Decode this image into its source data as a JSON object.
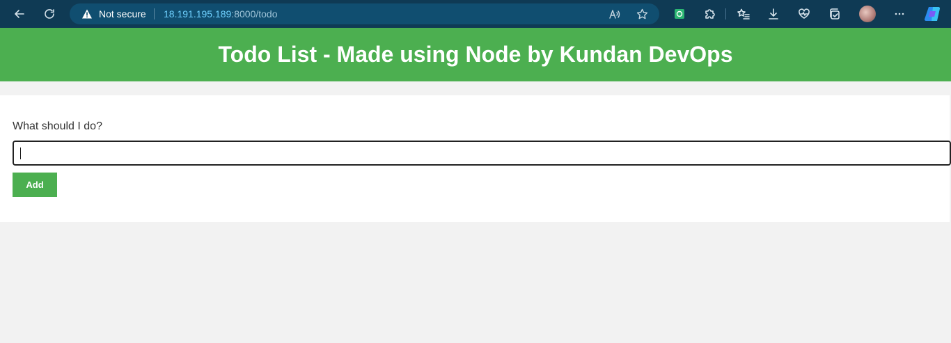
{
  "browser": {
    "security_label": "Not secure",
    "url_host": "18.191.195.189",
    "url_path": ":8000/todo",
    "icons": {
      "back": "back-arrow-icon",
      "refresh": "refresh-icon",
      "warning": "warning-triangle-icon",
      "read_aloud": "read-aloud-icon",
      "favorite": "star-icon",
      "extension1": "green-extension-icon",
      "extensions": "puzzle-icon",
      "favorites": "favorites-list-icon",
      "downloads": "download-icon",
      "health": "browser-essentials-icon",
      "collections": "collections-icon",
      "profile": "avatar",
      "more": "more-icon",
      "copilot": "copilot-icon"
    }
  },
  "header": {
    "title": "Todo List - Made using Node by Kundan DevOps",
    "color": "#4caf50"
  },
  "form": {
    "label": "What should I do?",
    "input_value": "",
    "add_label": "Add"
  }
}
